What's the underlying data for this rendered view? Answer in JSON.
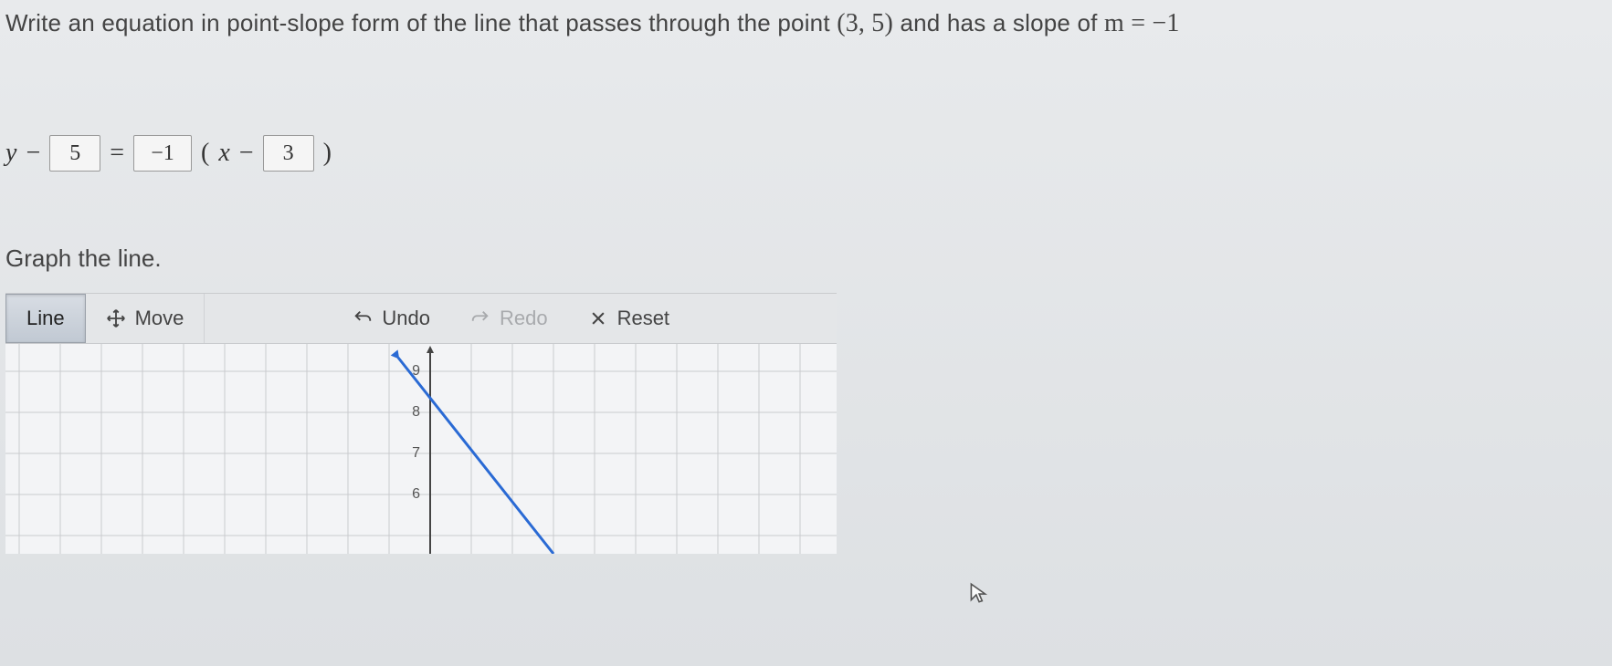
{
  "question": {
    "prefix": "Write an equation in point-slope form of the line that passes through the point ",
    "point": "(3, 5)",
    "middle": "  and has a slope of ",
    "slope_expr": "m = −1"
  },
  "equation": {
    "y_label": "y",
    "minus": "−",
    "box1": "5",
    "equals": "=",
    "box2": "−1",
    "lparen": "(",
    "x_label": "x",
    "box3": "3",
    "rparen": ")"
  },
  "subprompt": "Graph the line.",
  "toolbar": {
    "line": "Line",
    "move": "Move",
    "undo": "Undo",
    "redo": "Redo",
    "reset": "Reset"
  },
  "axis_numbers": [
    "9",
    "8",
    "7",
    "6"
  ],
  "chart_data": {
    "type": "line",
    "title": "",
    "xlabel": "",
    "ylabel": "",
    "xlim": [
      -10,
      10
    ],
    "ylim": [
      6,
      10
    ],
    "line_expression": "y = -1*(x - 3) + 5",
    "points": [
      {
        "x": -2,
        "y": 10
      },
      {
        "x": 3,
        "y": 5
      }
    ],
    "grid": true
  }
}
